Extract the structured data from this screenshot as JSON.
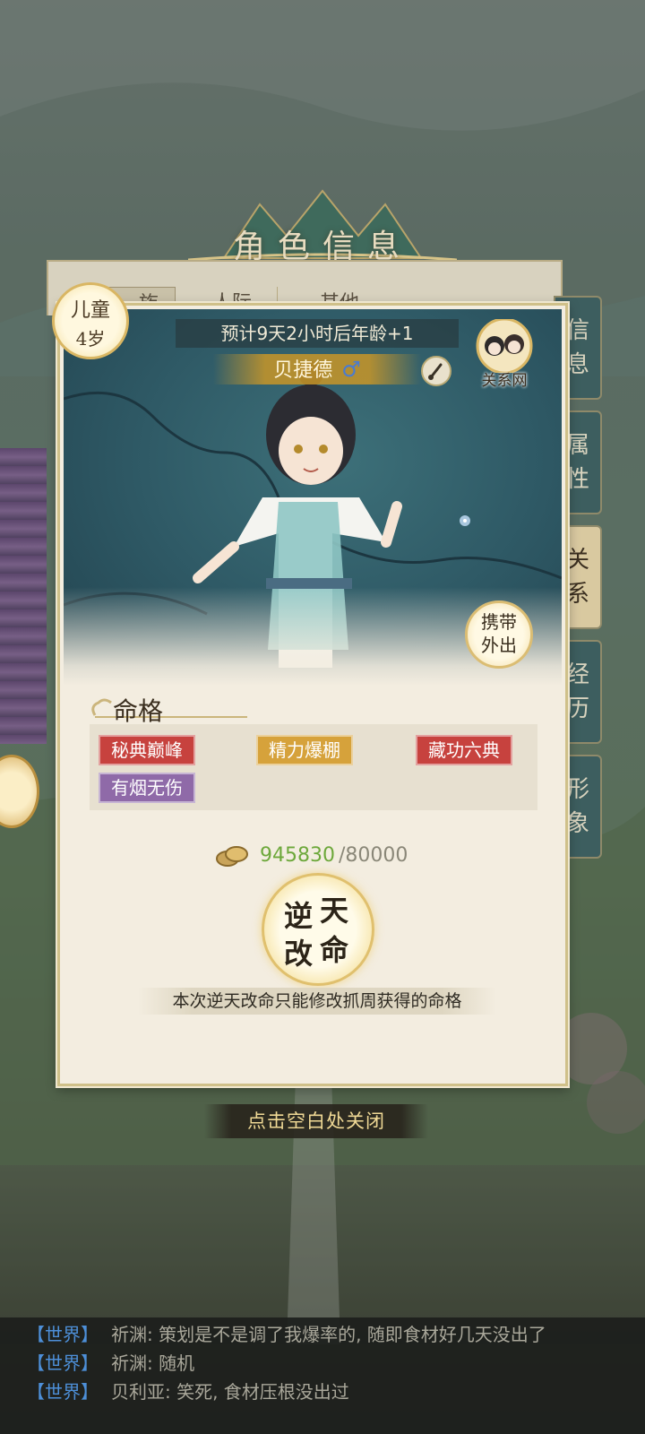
{
  "dialog": {
    "title": "角色信息",
    "tabs": [
      "…族",
      "人际",
      "其他"
    ],
    "close_hint": "点击空白处关闭"
  },
  "side_tabs": [
    {
      "label": "信息",
      "active": false
    },
    {
      "label": "属性",
      "active": false
    },
    {
      "label": "关系",
      "active": true
    },
    {
      "label": "经历",
      "active": false
    },
    {
      "label": "形象",
      "active": false
    }
  ],
  "character": {
    "stage": "儿童",
    "age": "4岁",
    "countdown": "预计9天2小时后年龄+1",
    "name": "贝捷德",
    "gender_symbol": "♂",
    "relation_label": "关系网",
    "carry_label_1": "携带",
    "carry_label_2": "外出"
  },
  "destiny": {
    "title": "命格",
    "tags": [
      {
        "label": "秘典巅峰",
        "color": "#c7423e"
      },
      {
        "label": "精力爆棚",
        "color": "#d6a23b"
      },
      {
        "label": "藏功六典",
        "color": "#c7423e"
      },
      {
        "label": "有烟无伤",
        "color": "#8f6aa8"
      }
    ]
  },
  "cost": {
    "have": "945830",
    "need": "/80000"
  },
  "fate_button": {
    "chars": [
      "逆",
      "天",
      "改",
      "命"
    ]
  },
  "notice": "本次逆天改命只能修改抓周获得的命格",
  "chat": [
    {
      "channel": "【世界】",
      "text": "祈渊: 策划是不是调了我爆率的, 随即食材好几天没出了"
    },
    {
      "channel": "【世界】",
      "text": "祈渊: 随机"
    },
    {
      "channel": "【世界】",
      "text": "贝利亚: 笑死, 食材压根没出过"
    }
  ]
}
